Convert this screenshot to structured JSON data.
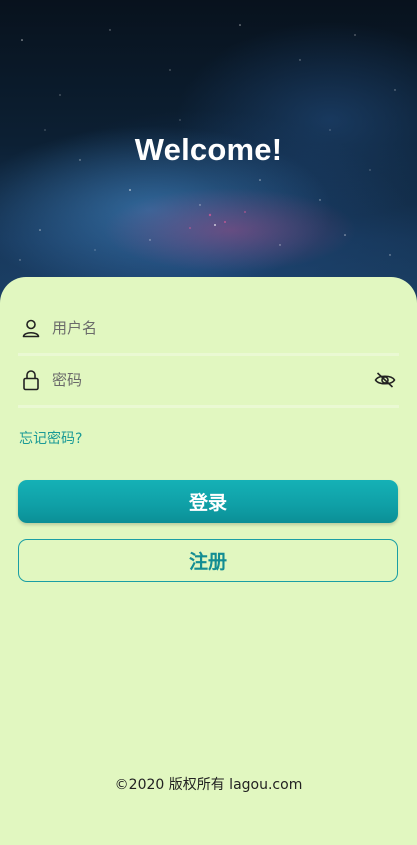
{
  "header": {
    "title": "Welcome!"
  },
  "form": {
    "username_placeholder": "用户名",
    "password_placeholder": "密码",
    "forgot_label": "忘记密码?",
    "login_label": "登录",
    "register_label": "注册"
  },
  "footer": {
    "copyright": "©2020 版权所有 lagou.com"
  },
  "icons": {
    "username": "user-icon",
    "password": "lock-icon",
    "toggle": "eye-off-icon"
  },
  "colors": {
    "card_bg": "#e1f7c0",
    "accent": "#0f9fa6",
    "link": "#1a9a96"
  }
}
